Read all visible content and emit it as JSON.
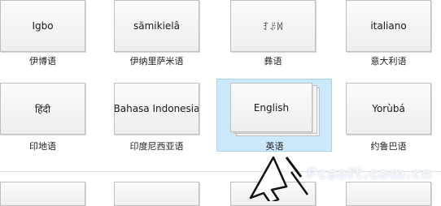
{
  "languages_row1": [
    {
      "tile": "Igbo",
      "caption": "伊博语"
    },
    {
      "tile": "sãmikielâ",
      "caption": "伊纳里萨米语"
    },
    {
      "tile": "ꆈꌠꉙ",
      "caption": "彝语"
    },
    {
      "tile": "italiano",
      "caption": "意大利语"
    }
  ],
  "languages_row2": [
    {
      "tile": "हिंदी",
      "caption": "印地语"
    },
    {
      "tile": "Bahasa Indonesia",
      "caption": "印度尼西亚语"
    },
    {
      "tile": "English",
      "caption": "英语"
    },
    {
      "tile": "Yorùbá",
      "caption": "约鲁巴语"
    }
  ],
  "selected_language": "English",
  "colors": {
    "selection": "#cce8fb",
    "tile_border": "#bfbfbf"
  },
  "watermark": "Pcsoft.com.cn"
}
